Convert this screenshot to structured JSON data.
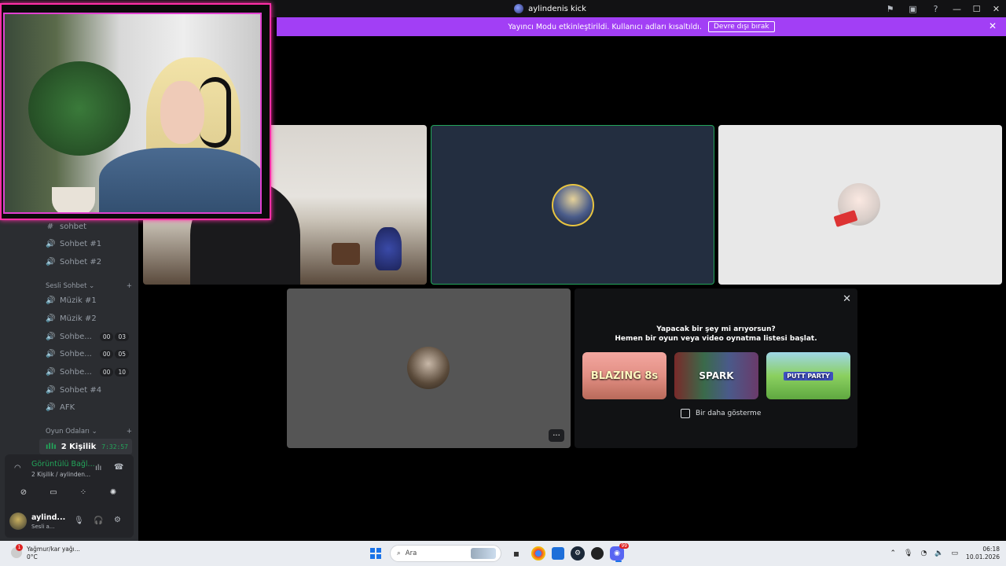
{
  "window": {
    "title": "aylindenis kick",
    "controls": {
      "minimize": "—",
      "maximize": "☐",
      "close": "✕"
    },
    "icons": [
      "inbox-icon",
      "screen-icon",
      "help-icon"
    ]
  },
  "banner": {
    "message": "Yayıncı Modu etkinleştirildi. Kullanıcı adları kısaltıldı.",
    "button": "Devre dışı bırak",
    "close": "✕",
    "color": "#a23ff5"
  },
  "sidebar": {
    "channels_top": [
      {
        "icon": "#",
        "label": "sohbet"
      },
      {
        "icon": "🔊",
        "label": "Sohbet #1"
      },
      {
        "icon": "🔊",
        "label": "Sohbet #2"
      }
    ],
    "voice_category": {
      "label": "Sesli Sohbet ⌄",
      "add": "+"
    },
    "voice_channels": [
      {
        "icon": "🔊",
        "label": "Müzik #1"
      },
      {
        "icon": "🔊",
        "label": "Müzik #2"
      },
      {
        "icon": "🔊",
        "label": "Sohbe...",
        "badge": [
          "00",
          "03"
        ]
      },
      {
        "icon": "🔊",
        "label": "Sohbe...",
        "badge": [
          "00",
          "05"
        ]
      },
      {
        "icon": "🔊",
        "label": "Sohbe...",
        "badge": [
          "00",
          "10"
        ]
      },
      {
        "icon": "🔊",
        "label": "Sohbet #4"
      },
      {
        "icon": "🔊",
        "label": "AFK"
      }
    ],
    "game_category": {
      "label": "Oyun Odaları ⌄",
      "add": "+"
    },
    "active_channel": {
      "label": "2 Kişilik",
      "time": "7:32:57"
    }
  },
  "voice_panel": {
    "status": "Görüntülü Bağl...",
    "subtitle": "2 Kişilik / aylinden...",
    "user": {
      "name": "aylind...",
      "status": "Sesli a..."
    }
  },
  "activity": {
    "line1": "Yapacak bir şey mi arıyorsun?",
    "line2": "Hemen bir oyun veya video oynatma listesi başlat.",
    "games": [
      "BLAZING 8s",
      "SPARK",
      "PUTT PARTY"
    ],
    "checkbox_label": "Bir daha gösterme",
    "close": "✕"
  },
  "tiles": {
    "more_label": "···"
  },
  "taskbar": {
    "weather": {
      "condition": "Yağmur/kar yağı...",
      "temp": "0°C",
      "alert": "1"
    },
    "search_placeholder": "Ara",
    "time": "06:18",
    "date": "10.01.2026",
    "discord_badge": "99"
  }
}
